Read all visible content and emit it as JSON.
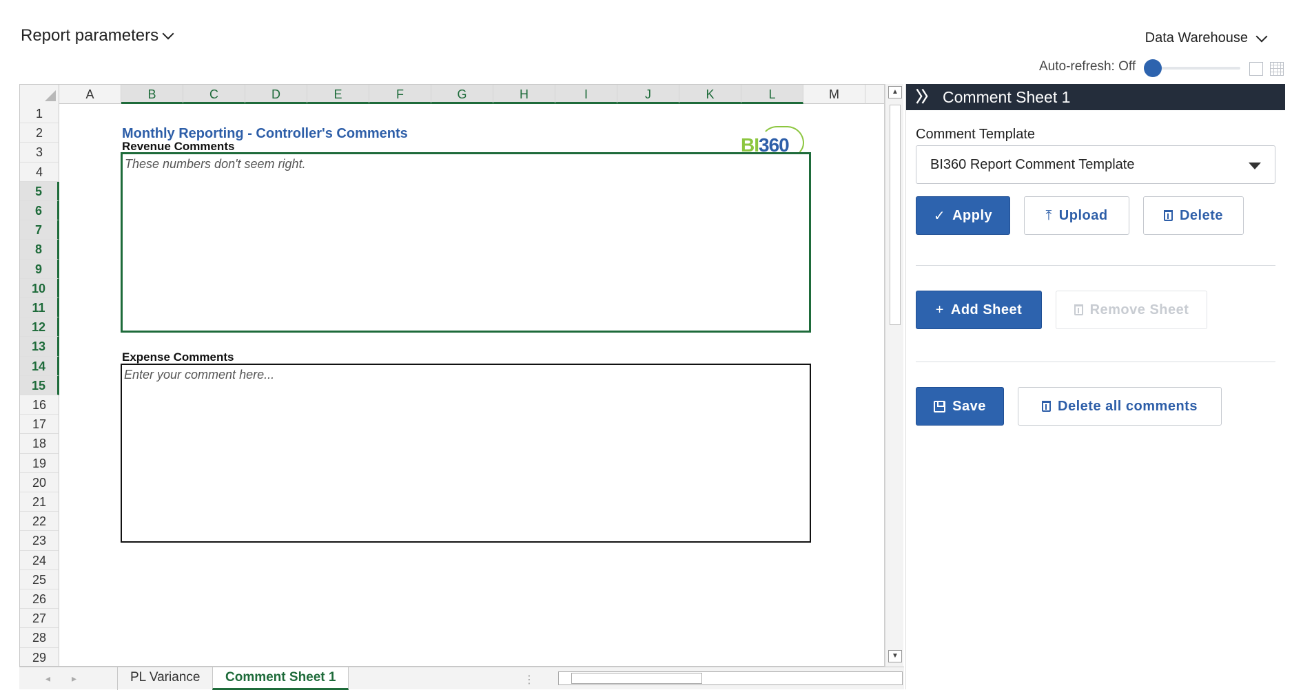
{
  "topbar": {
    "report_parameters": "Report parameters",
    "data_source": "Data Warehouse",
    "auto_refresh": "Auto-refresh: Off"
  },
  "sheet": {
    "columns": [
      "A",
      "B",
      "C",
      "D",
      "E",
      "F",
      "G",
      "H",
      "I",
      "J",
      "K",
      "L",
      "M"
    ],
    "selected_columns": [
      "B",
      "C",
      "D",
      "E",
      "F",
      "G",
      "H",
      "I",
      "J",
      "K",
      "L"
    ],
    "rows": [
      "1",
      "2",
      "3",
      "4",
      "5",
      "6",
      "7",
      "8",
      "9",
      "10",
      "11",
      "12",
      "13",
      "14",
      "15",
      "16",
      "17",
      "18",
      "19",
      "20",
      "21",
      "22",
      "23",
      "24",
      "25",
      "26",
      "27",
      "28",
      "29"
    ],
    "selected_rows": [
      "5",
      "6",
      "7",
      "8",
      "9",
      "10",
      "11",
      "12",
      "13",
      "14",
      "15"
    ],
    "title": "Monthly Reporting - Controller's Comments",
    "logo": "BI360",
    "revenue_label": "Revenue Comments",
    "revenue_text": "These numbers don't seem right.",
    "expense_label": "Expense Comments",
    "expense_placeholder": "Enter your comment here..."
  },
  "tabs": [
    {
      "label": "PL Variance",
      "active": false
    },
    {
      "label": "Comment Sheet 1",
      "active": true
    }
  ],
  "panel": {
    "title": "Comment Sheet 1",
    "template_label": "Comment Template",
    "template_value": "BI360 Report Comment Template",
    "apply": "Apply",
    "upload": "Upload",
    "delete": "Delete",
    "add_sheet": "Add Sheet",
    "remove_sheet": "Remove Sheet",
    "save": "Save",
    "delete_all": "Delete all comments"
  },
  "colors": {
    "primary": "#2d63ae",
    "panel_header": "#242d3b",
    "excel_green": "#1e6b3a",
    "title_blue": "#2d5ea8",
    "logo_green": "#8cc63f"
  }
}
